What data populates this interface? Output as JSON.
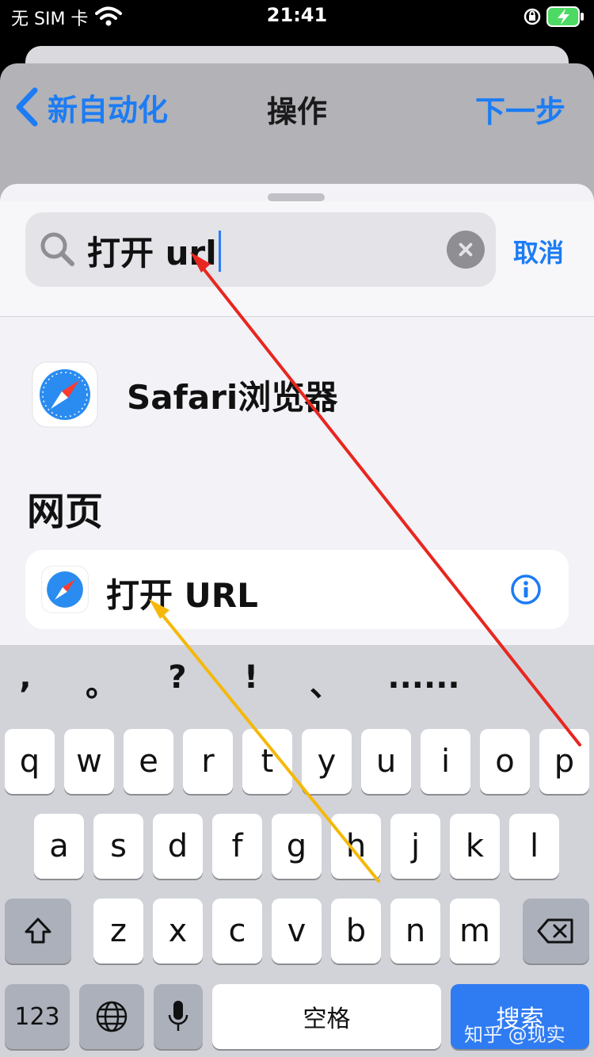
{
  "status": {
    "carrier": "无 SIM 卡",
    "time": "21:41"
  },
  "nav": {
    "back_label": "新自动化",
    "title": "操作",
    "next_label": "下一步"
  },
  "search": {
    "value": "打开 url",
    "cancel_label": "取消"
  },
  "results": {
    "app_label": "Safari浏览器",
    "section_title": "网页",
    "action_label": "打开 URL"
  },
  "keyboard": {
    "suggestions": [
      ",",
      "。",
      "?",
      "!",
      "、",
      "......"
    ],
    "row1": [
      "q",
      "w",
      "e",
      "r",
      "t",
      "y",
      "u",
      "i",
      "o",
      "p"
    ],
    "row2": [
      "a",
      "s",
      "d",
      "f",
      "g",
      "h",
      "j",
      "k",
      "l"
    ],
    "row3": [
      "z",
      "x",
      "c",
      "v",
      "b",
      "n",
      "m"
    ],
    "numbers_label": "123",
    "space_label": "空格",
    "search_label": "搜索"
  },
  "watermark": "知乎 @现实",
  "colors": {
    "accent": "#1c7cf4",
    "annotation_red": "#e8261f",
    "annotation_yellow": "#f5b80a"
  },
  "icons": [
    "wifi-icon",
    "orientation-lock-icon",
    "battery-charging-icon",
    "chevron-left-icon",
    "search-icon",
    "clear-icon",
    "safari-icon",
    "info-icon",
    "shift-icon",
    "delete-icon",
    "globe-icon",
    "microphone-icon"
  ]
}
